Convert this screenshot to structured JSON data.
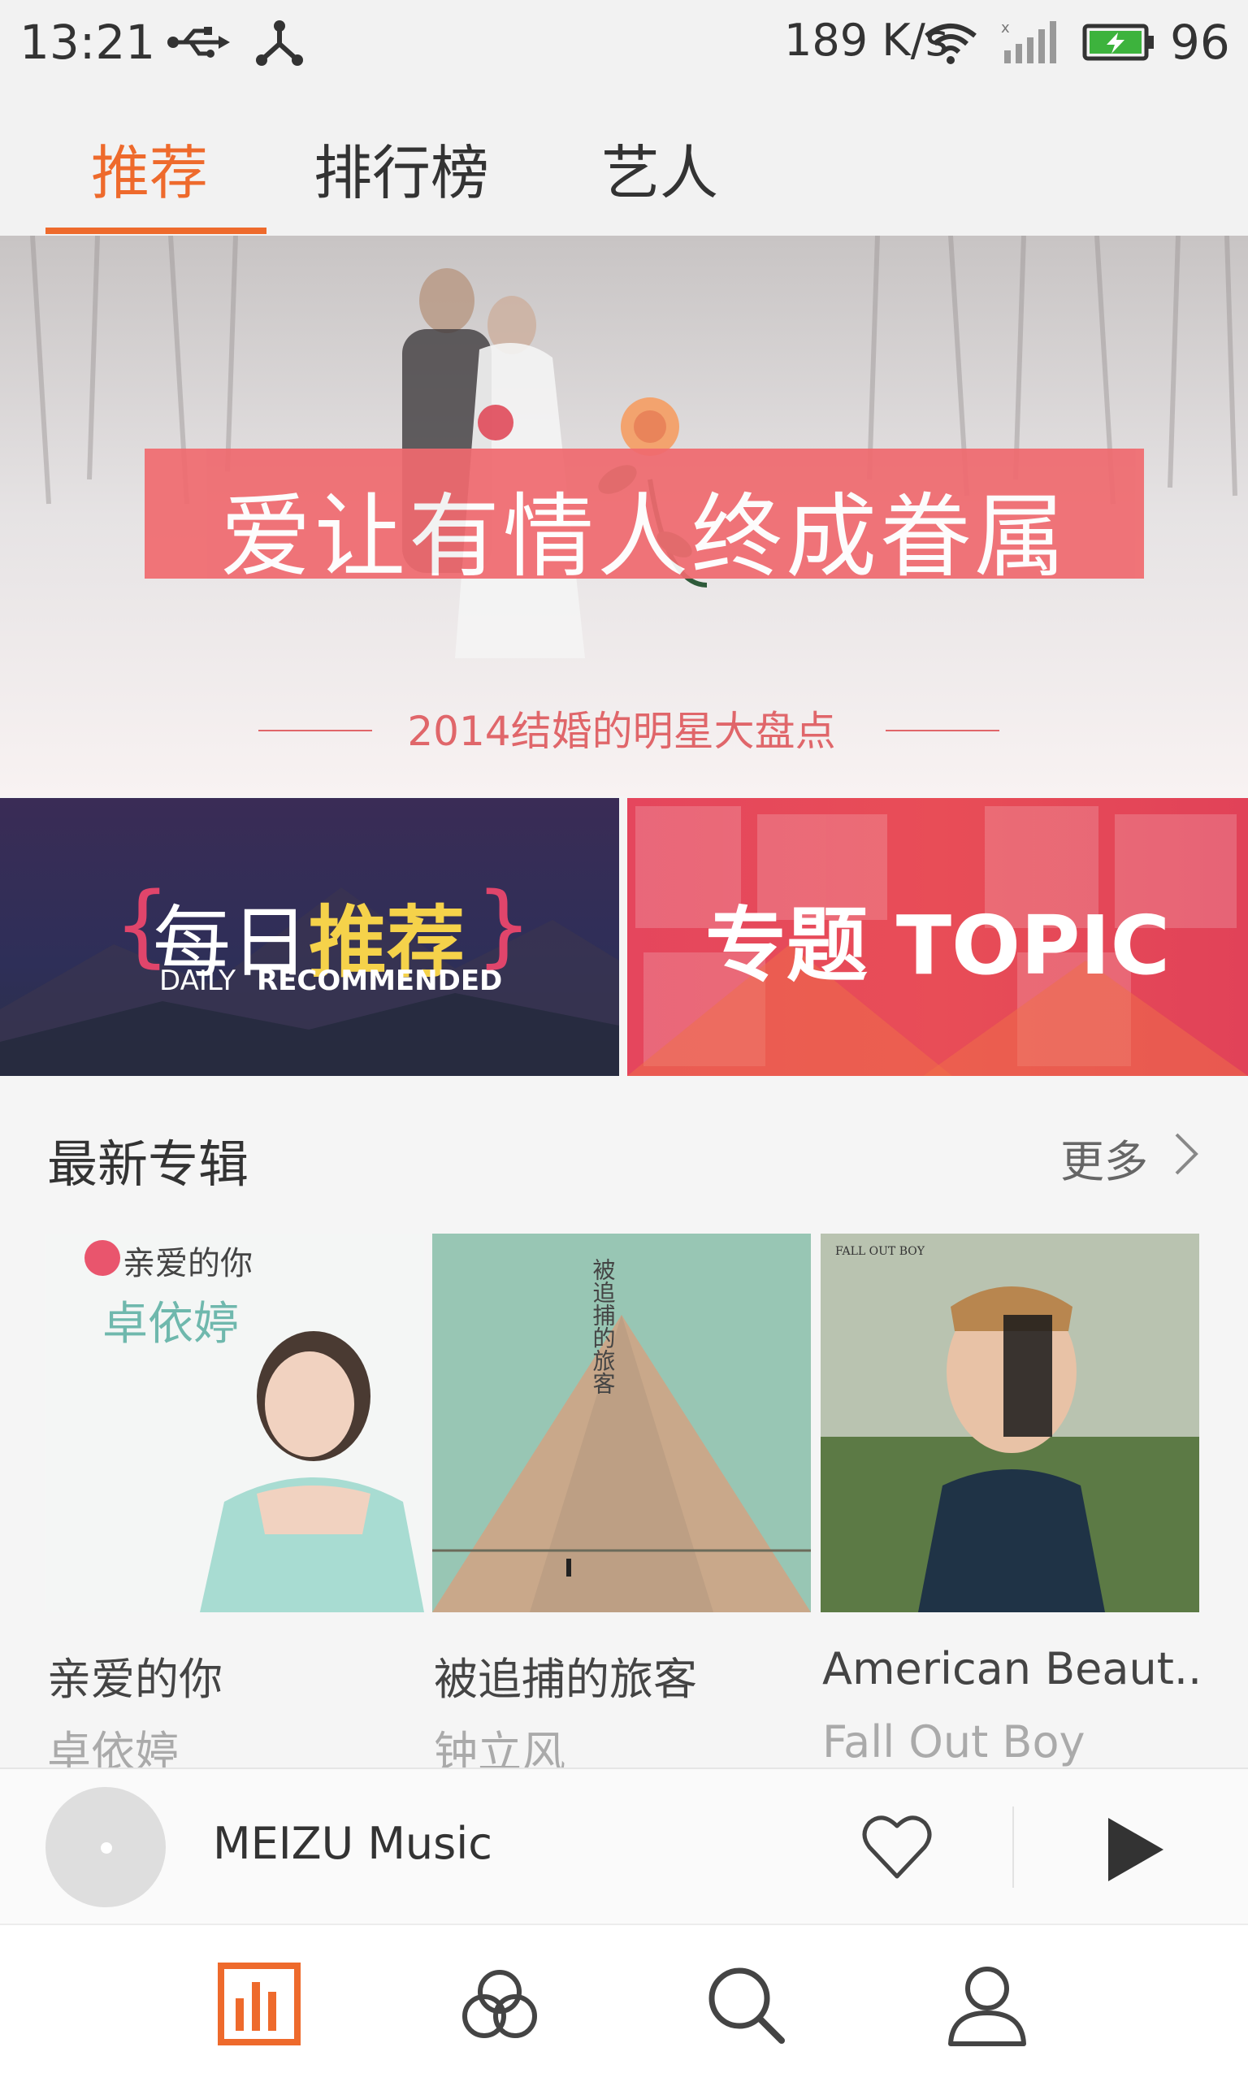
{
  "status_bar": {
    "time": "13:21",
    "net_speed": "189 K/s",
    "battery": "96",
    "icons": [
      "usb-icon",
      "share-icon",
      "wifi-icon",
      "signal-icon",
      "battery-icon"
    ]
  },
  "tabs": [
    {
      "label": "推荐",
      "active": true
    },
    {
      "label": "排行榜",
      "active": false
    },
    {
      "label": "艺人",
      "active": false
    }
  ],
  "hero": {
    "title": "爱让有情人终成眷属",
    "subtitle": "2014结婚的明星大盘点"
  },
  "promo": {
    "daily": {
      "cn_a": "每日",
      "cn_b": "推荐",
      "en_a": "DAILY",
      "en_b": "RECOMMENDED"
    },
    "topic": {
      "label": "专题 TOPIC"
    }
  },
  "section": {
    "title": "最新专辑",
    "more": "更多"
  },
  "albums": [
    {
      "title": "亲爱的你",
      "artist": "卓依婷",
      "cover_text": "亲爱的你"
    },
    {
      "title": "被追捕的旅客",
      "artist": "钟立风",
      "cover_text": "被追捕的旅客"
    },
    {
      "title": "American Beaut..",
      "artist": "Fall Out Boy",
      "cover_text": "FALL OUT BOY"
    }
  ],
  "player": {
    "title": "MEIZU Music"
  },
  "colors": {
    "accent": "#ee6a2c",
    "hero_box": "#f06a6f",
    "topic": "#e84d57",
    "daily": "#2e2f58"
  }
}
